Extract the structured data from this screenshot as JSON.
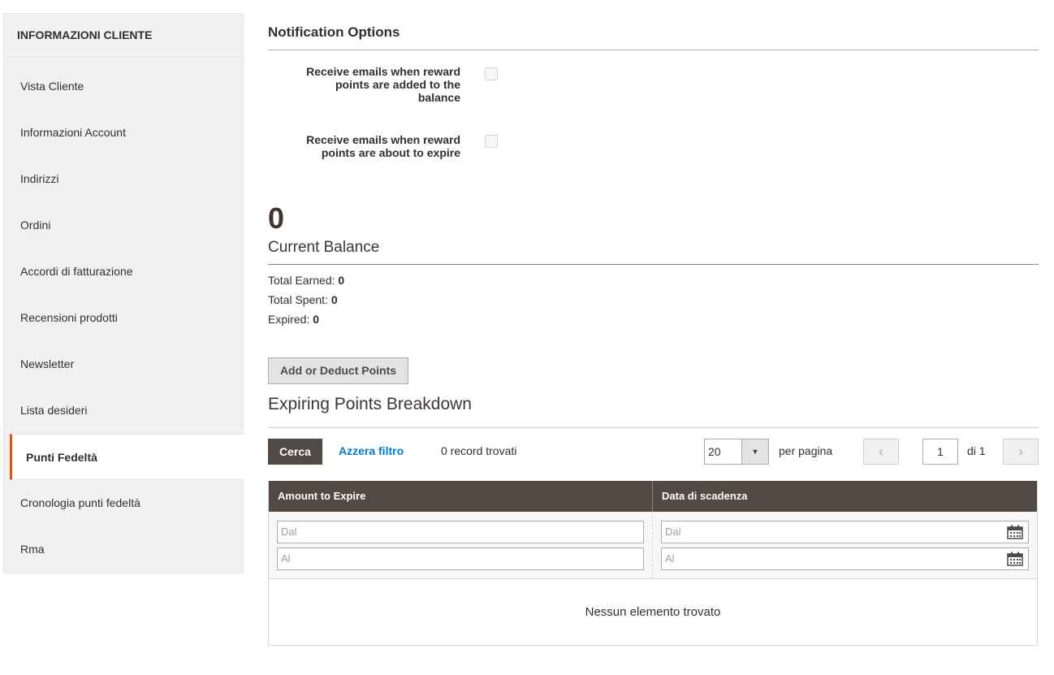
{
  "sidebar": {
    "title": "INFORMAZIONI CLIENTE",
    "items": [
      {
        "label": "Vista Cliente"
      },
      {
        "label": "Informazioni Account"
      },
      {
        "label": "Indirizzi"
      },
      {
        "label": "Ordini"
      },
      {
        "label": "Accordi di fatturazione"
      },
      {
        "label": "Recensioni prodotti"
      },
      {
        "label": "Newsletter"
      },
      {
        "label": "Lista desideri"
      },
      {
        "label": "Punti Fedeltà"
      },
      {
        "label": "Cronologia punti fedeltà"
      },
      {
        "label": "Rma"
      }
    ],
    "active_item": "Punti Fedeltà",
    "accent_color": "#eb5202"
  },
  "notifications": {
    "title": "Notification Options",
    "options": [
      {
        "label_line1": "Receive emails when reward",
        "label_line2": "points are added to the",
        "label_line3": "balance",
        "checked": false
      },
      {
        "label_line1": "Receive emails when reward",
        "label_line2": "points are about to expire",
        "checked": false
      }
    ]
  },
  "balance": {
    "value": "0",
    "label": "Current Balance",
    "total_earned_label": "Total Earned:",
    "total_earned": "0",
    "total_spent_label": "Total Spent:",
    "total_spent": "0",
    "expired_label": "Expired:",
    "expired": "0"
  },
  "actions": {
    "add_deduct_label": "Add or Deduct Points"
  },
  "breakdown": {
    "title": "Expiring Points Breakdown",
    "search_label": "Cerca",
    "reset_label": "Azzera filtro",
    "records_text": "0 record trovati",
    "per_page_value": "20",
    "per_page_label": "per pagina",
    "page_value": "1",
    "page_of": "di 1",
    "columns": [
      "Amount to Expire",
      "Data di scadenza"
    ],
    "filters": {
      "from_placeholder": "Dal",
      "to_placeholder": "Al"
    },
    "empty_text": "Nessun elemento trovato",
    "header_color": "#514943",
    "link_color": "#007bdb"
  },
  "icons": {
    "prev": "chevron-left-icon",
    "next": "chevron-right-icon",
    "calendar": "calendar-icon",
    "dropdown": "triangle-down-icon"
  }
}
